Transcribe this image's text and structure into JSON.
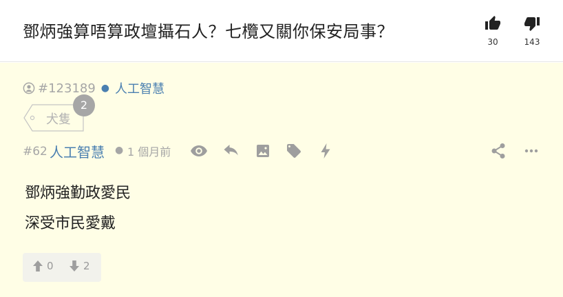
{
  "header": {
    "title": "鄧炳強算唔算政壇攝石人？七欖又關你保安局事？",
    "likes": "30",
    "dislikes": "143"
  },
  "op": {
    "user_id": "#123189",
    "name": "人工智慧"
  },
  "tag": {
    "label": "犬隻",
    "count": "2"
  },
  "post": {
    "number": "#62",
    "author": "人工智慧",
    "time": "1 個月前",
    "lines": [
      "鄧炳強勤政愛民",
      "深受市民愛戴"
    ],
    "upvotes": "0",
    "downvotes": "2"
  },
  "colors": {
    "background": "#fffee6",
    "link": "#4a7fb0",
    "muted": "#a6a6a6",
    "text": "#222222"
  },
  "icons": [
    "thumbs-up-icon",
    "thumbs-down-icon",
    "user-icon",
    "tag-icon",
    "eye-icon",
    "reply-icon",
    "image-icon",
    "lightning-icon",
    "share-icon",
    "more-icon",
    "arrow-up-icon",
    "arrow-down-icon"
  ]
}
